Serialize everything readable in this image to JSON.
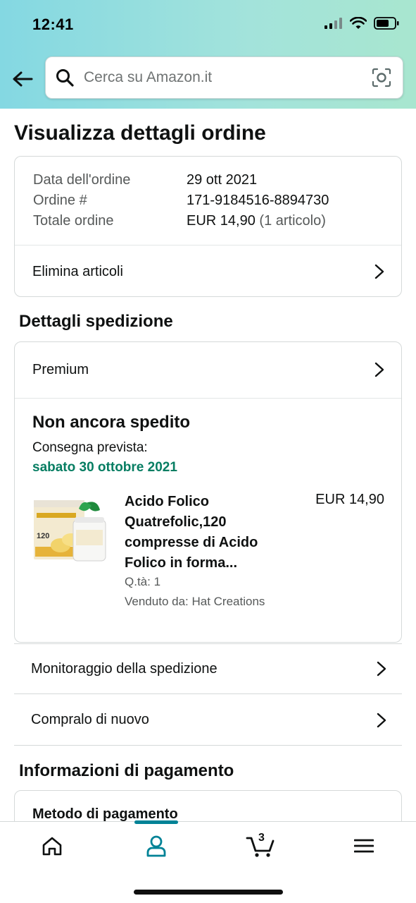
{
  "status_bar": {
    "time": "12:41"
  },
  "search": {
    "placeholder": "Cerca su Amazon.it"
  },
  "page_title": "Visualizza dettagli ordine",
  "order": {
    "date_label": "Data dell'ordine",
    "date_value": "29 ott 2021",
    "number_label": "Ordine #",
    "number_value": "171-9184516-8894730",
    "total_label": "Totale ordine",
    "total_value": "EUR 14,90",
    "total_items": "(1 articolo)",
    "delete_label": "Elimina articoli"
  },
  "shipping": {
    "section_title": "Dettagli spedizione",
    "speed": "Premium",
    "status": "Non ancora spedito",
    "delivery_label": "Consegna prevista:",
    "delivery_date": "sabato 30 ottobre 2021",
    "product": {
      "name": "Acido Folico Quatrefolic,120 compresse di Acido Folico in forma...",
      "price": "EUR 14,90",
      "qty": "Q.tà: 1",
      "seller": "Venduto da: Hat Creations"
    },
    "track_label": "Monitoraggio della spedizione",
    "buy_again_label": "Compralo di nuovo"
  },
  "payment": {
    "section_title": "Informazioni di pagamento",
    "method_label": "Metodo di pagamento"
  },
  "tabbar": {
    "cart_count": "3",
    "active_tab": "account"
  },
  "colors": {
    "accent": "#008296",
    "delivery_green": "#067d62",
    "header_gradient_start": "#84d8e2",
    "header_gradient_end": "#a8e6cf"
  }
}
